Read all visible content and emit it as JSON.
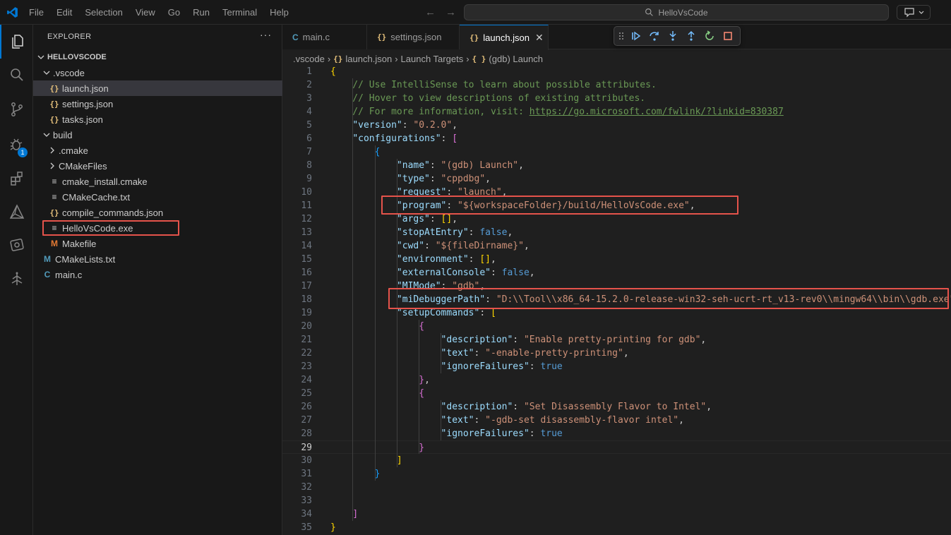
{
  "menu": [
    "File",
    "Edit",
    "Selection",
    "View",
    "Go",
    "Run",
    "Terminal",
    "Help"
  ],
  "command_center": {
    "label": "HelloVsCode"
  },
  "activity": {
    "run_debug_badge": "1"
  },
  "sidebar": {
    "title": "EXPLORER",
    "more": "···",
    "tree": [
      {
        "label": "HELLOVSCODE",
        "indent": 0,
        "chevron": "down",
        "icon": "",
        "root": true
      },
      {
        "label": ".vscode",
        "indent": 1,
        "chevron": "down",
        "icon": ""
      },
      {
        "label": "launch.json",
        "indent": 2,
        "chevron": "",
        "icon": "{}",
        "selected": true
      },
      {
        "label": "settings.json",
        "indent": 2,
        "chevron": "",
        "icon": "{}"
      },
      {
        "label": "tasks.json",
        "indent": 2,
        "chevron": "",
        "icon": "{}"
      },
      {
        "label": "build",
        "indent": 1,
        "chevron": "down",
        "icon": ""
      },
      {
        "label": ".cmake",
        "indent": 2,
        "chevron": "right",
        "icon": ""
      },
      {
        "label": "CMakeFiles",
        "indent": 2,
        "chevron": "right",
        "icon": ""
      },
      {
        "label": "cmake_install.cmake",
        "indent": 2,
        "chevron": "",
        "icon": "lines"
      },
      {
        "label": "CMakeCache.txt",
        "indent": 2,
        "chevron": "",
        "icon": "lines"
      },
      {
        "label": "compile_commands.json",
        "indent": 2,
        "chevron": "",
        "icon": "{}"
      },
      {
        "label": "HelloVsCode.exe",
        "indent": 2,
        "chevron": "",
        "icon": "lines",
        "boxed": true
      },
      {
        "label": "Makefile",
        "indent": 2,
        "chevron": "",
        "icon": "M"
      },
      {
        "label": "CMakeLists.txt",
        "indent": 1,
        "chevron": "",
        "icon": "CM"
      },
      {
        "label": "main.c",
        "indent": 1,
        "chevron": "",
        "icon": "C"
      }
    ]
  },
  "tabs": [
    {
      "label": "main.c",
      "icon": "C",
      "active": false
    },
    {
      "label": "settings.json",
      "icon": "{}",
      "active": false
    },
    {
      "label": "launch.json",
      "icon": "{}",
      "active": true,
      "close": "✕"
    }
  ],
  "breadcrumbs": [
    ".vscode",
    "launch.json",
    "Launch Targets",
    "(gdb) Launch"
  ],
  "breadcrumb_icons": [
    "",
    "{}",
    "",
    "{ }"
  ],
  "colors": {
    "accent": "#0078d4",
    "highlight_box": "#e5534b",
    "key": "#9cdcfe",
    "string": "#ce9178",
    "comment": "#6a9955",
    "keyword": "#569cd6"
  },
  "current_line": 29,
  "code_lines": [
    [
      [
        "b1",
        "{"
      ]
    ],
    [
      [
        "c",
        "    // Use IntelliSense to learn about possible attributes."
      ]
    ],
    [
      [
        "c",
        "    // Hover to view descriptions of existing attributes."
      ]
    ],
    [
      [
        "c",
        "    // For more information, visit: "
      ],
      [
        "u",
        "https://go.microsoft.com/fwlink/?linkid=830387"
      ]
    ],
    [
      [
        "p",
        "    "
      ],
      [
        "k",
        "\"version\""
      ],
      [
        "p",
        ": "
      ],
      [
        "s",
        "\"0.2.0\""
      ],
      [
        "p",
        ","
      ]
    ],
    [
      [
        "p",
        "    "
      ],
      [
        "k",
        "\"configurations\""
      ],
      [
        "p",
        ": "
      ],
      [
        "b2",
        "["
      ]
    ],
    [
      [
        "p",
        "        "
      ],
      [
        "b3",
        "{"
      ]
    ],
    [
      [
        "p",
        "            "
      ],
      [
        "k",
        "\"name\""
      ],
      [
        "p",
        ": "
      ],
      [
        "s",
        "\"(gdb) Launch\""
      ],
      [
        "p",
        ","
      ]
    ],
    [
      [
        "p",
        "            "
      ],
      [
        "k",
        "\"type\""
      ],
      [
        "p",
        ": "
      ],
      [
        "s",
        "\"cppdbg\""
      ],
      [
        "p",
        ","
      ]
    ],
    [
      [
        "p",
        "            "
      ],
      [
        "k",
        "\"request\""
      ],
      [
        "p",
        ": "
      ],
      [
        "s",
        "\"launch\""
      ],
      [
        "p",
        ","
      ]
    ],
    [
      [
        "p",
        "            "
      ],
      [
        "k",
        "\"program\""
      ],
      [
        "p",
        ": "
      ],
      [
        "s",
        "\"${workspaceFolder}/build/HelloVsCode.exe\""
      ],
      [
        "p",
        ","
      ]
    ],
    [
      [
        "p",
        "            "
      ],
      [
        "k",
        "\"args\""
      ],
      [
        "p",
        ": "
      ],
      [
        "b1",
        "[]"
      ],
      [
        "p",
        ","
      ]
    ],
    [
      [
        "p",
        "            "
      ],
      [
        "k",
        "\"stopAtEntry\""
      ],
      [
        "p",
        ": "
      ],
      [
        "kw",
        "false"
      ],
      [
        "p",
        ","
      ]
    ],
    [
      [
        "p",
        "            "
      ],
      [
        "k",
        "\"cwd\""
      ],
      [
        "p",
        ": "
      ],
      [
        "s",
        "\"${fileDirname}\""
      ],
      [
        "p",
        ","
      ]
    ],
    [
      [
        "p",
        "            "
      ],
      [
        "k",
        "\"environment\""
      ],
      [
        "p",
        ": "
      ],
      [
        "b1",
        "[]"
      ],
      [
        "p",
        ","
      ]
    ],
    [
      [
        "p",
        "            "
      ],
      [
        "k",
        "\"externalConsole\""
      ],
      [
        "p",
        ": "
      ],
      [
        "kw",
        "false"
      ],
      [
        "p",
        ","
      ]
    ],
    [
      [
        "p",
        "            "
      ],
      [
        "k",
        "\"MIMode\""
      ],
      [
        "p",
        ": "
      ],
      [
        "s",
        "\"gdb\""
      ],
      [
        "p",
        ","
      ]
    ],
    [
      [
        "p",
        "            "
      ],
      [
        "k",
        "\"miDebuggerPath\""
      ],
      [
        "p",
        ": "
      ],
      [
        "s",
        "\"D:\\\\Tool\\\\x86_64-15.2.0-release-win32-seh-ucrt-rt_v13-rev0\\\\mingw64\\\\bin\\\\gdb.exe\""
      ],
      [
        "p",
        ","
      ]
    ],
    [
      [
        "p",
        "            "
      ],
      [
        "k",
        "\"setupCommands\""
      ],
      [
        "p",
        ": "
      ],
      [
        "b1",
        "["
      ]
    ],
    [
      [
        "p",
        "                "
      ],
      [
        "b2",
        "{"
      ]
    ],
    [
      [
        "p",
        "                    "
      ],
      [
        "k",
        "\"description\""
      ],
      [
        "p",
        ": "
      ],
      [
        "s",
        "\"Enable pretty-printing for gdb\""
      ],
      [
        "p",
        ","
      ]
    ],
    [
      [
        "p",
        "                    "
      ],
      [
        "k",
        "\"text\""
      ],
      [
        "p",
        ": "
      ],
      [
        "s",
        "\"-enable-pretty-printing\""
      ],
      [
        "p",
        ","
      ]
    ],
    [
      [
        "p",
        "                    "
      ],
      [
        "k",
        "\"ignoreFailures\""
      ],
      [
        "p",
        ": "
      ],
      [
        "kw",
        "true"
      ]
    ],
    [
      [
        "p",
        "                "
      ],
      [
        "b2",
        "}"
      ],
      [
        "p",
        ","
      ]
    ],
    [
      [
        "p",
        "                "
      ],
      [
        "b2",
        "{"
      ]
    ],
    [
      [
        "p",
        "                    "
      ],
      [
        "k",
        "\"description\""
      ],
      [
        "p",
        ": "
      ],
      [
        "s",
        "\"Set Disassembly Flavor to Intel\""
      ],
      [
        "p",
        ","
      ]
    ],
    [
      [
        "p",
        "                    "
      ],
      [
        "k",
        "\"text\""
      ],
      [
        "p",
        ": "
      ],
      [
        "s",
        "\"-gdb-set disassembly-flavor intel\""
      ],
      [
        "p",
        ","
      ]
    ],
    [
      [
        "p",
        "                    "
      ],
      [
        "k",
        "\"ignoreFailures\""
      ],
      [
        "p",
        ": "
      ],
      [
        "kw",
        "true"
      ]
    ],
    [
      [
        "p",
        "                "
      ],
      [
        "b2",
        "}"
      ]
    ],
    [
      [
        "p",
        "            "
      ],
      [
        "b1",
        "]"
      ]
    ],
    [
      [
        "p",
        "        "
      ],
      [
        "b3",
        "}"
      ]
    ],
    [],
    [],
    [
      [
        "p",
        "    "
      ],
      [
        "b2",
        "]"
      ]
    ],
    [
      [
        "b1",
        "}"
      ]
    ]
  ]
}
